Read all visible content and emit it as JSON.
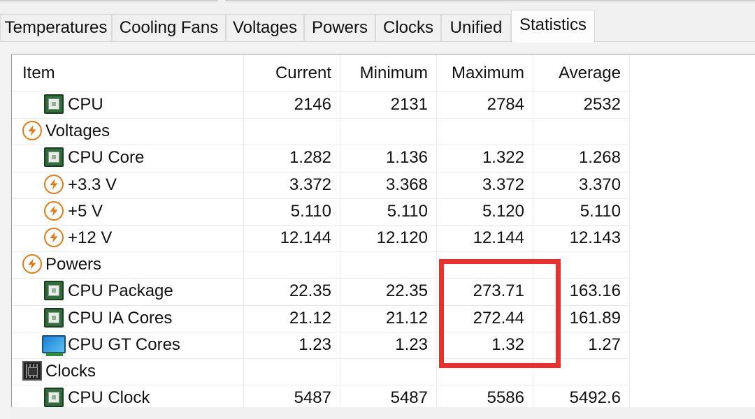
{
  "tabs": [
    {
      "label": "Temperatures",
      "active": false
    },
    {
      "label": "Cooling Fans",
      "active": false
    },
    {
      "label": "Voltages",
      "active": false
    },
    {
      "label": "Powers",
      "active": false
    },
    {
      "label": "Clocks",
      "active": false
    },
    {
      "label": "Unified",
      "active": false
    },
    {
      "label": "Statistics",
      "active": true
    }
  ],
  "columns": [
    "Item",
    "Current",
    "Minimum",
    "Maximum",
    "Average"
  ],
  "rows": [
    {
      "type": "item",
      "icon": "chip-icon",
      "label": "CPU",
      "current": "2146",
      "minimum": "2131",
      "maximum": "2784",
      "average": "2532"
    },
    {
      "type": "group",
      "icon": "bolt-icon",
      "label": "Voltages"
    },
    {
      "type": "item",
      "icon": "chip-icon",
      "label": "CPU Core",
      "current": "1.282",
      "minimum": "1.136",
      "maximum": "1.322",
      "average": "1.268"
    },
    {
      "type": "item",
      "icon": "bolt-icon",
      "label": "+3.3 V",
      "current": "3.372",
      "minimum": "3.368",
      "maximum": "3.372",
      "average": "3.370"
    },
    {
      "type": "item",
      "icon": "bolt-icon",
      "label": "+5 V",
      "current": "5.110",
      "minimum": "5.110",
      "maximum": "5.120",
      "average": "5.110"
    },
    {
      "type": "item",
      "icon": "bolt-icon",
      "label": "+12 V",
      "current": "12.144",
      "minimum": "12.120",
      "maximum": "12.144",
      "average": "12.143"
    },
    {
      "type": "group",
      "icon": "bolt-icon",
      "label": "Powers"
    },
    {
      "type": "item",
      "icon": "chip-icon",
      "label": "CPU Package",
      "current": "22.35",
      "minimum": "22.35",
      "maximum": "273.71",
      "average": "163.16"
    },
    {
      "type": "item",
      "icon": "chip-icon",
      "label": "CPU IA Cores",
      "current": "21.12",
      "minimum": "21.12",
      "maximum": "272.44",
      "average": "161.89"
    },
    {
      "type": "item",
      "icon": "gpu-icon",
      "label": "CPU GT Cores",
      "current": "1.23",
      "minimum": "1.23",
      "maximum": "1.32",
      "average": "1.27"
    },
    {
      "type": "group",
      "icon": "clock-chip-icon",
      "label": "Clocks"
    },
    {
      "type": "item",
      "icon": "chip-icon",
      "label": "CPU Clock",
      "current": "5487",
      "minimum": "5487",
      "maximum": "5586",
      "average": "5492.6"
    }
  ],
  "colors": {
    "highlight": "#e8312f",
    "bolt": "#e07b18"
  }
}
